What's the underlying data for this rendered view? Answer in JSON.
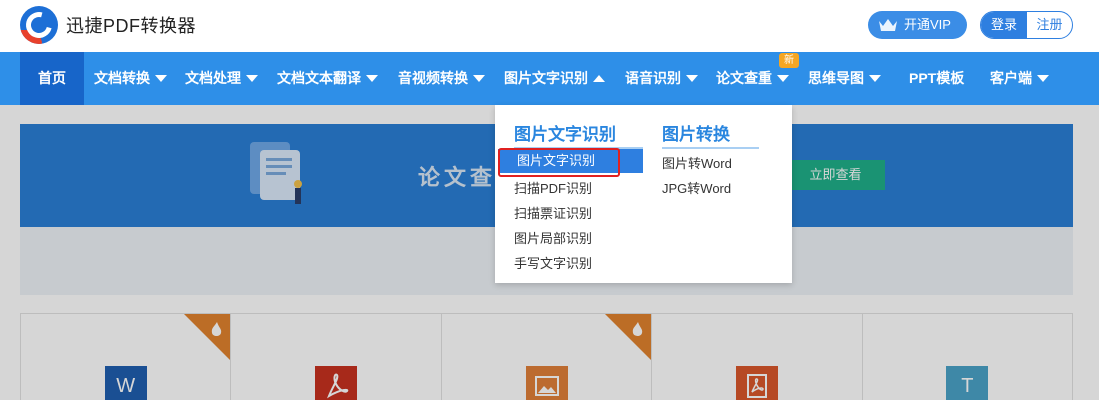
{
  "header": {
    "brand": "迅捷PDF转换器",
    "vip_label": "开通VIP",
    "login_label": "登录",
    "register_label": "注册"
  },
  "nav": {
    "items": [
      {
        "label": "首页"
      },
      {
        "label": "文档转换"
      },
      {
        "label": "文档处理"
      },
      {
        "label": "文档文本翻译"
      },
      {
        "label": "音视频转换"
      },
      {
        "label": "图片文字识别"
      },
      {
        "label": "语音识别"
      },
      {
        "label": "论文查重"
      },
      {
        "label": "思维导图"
      },
      {
        "label": "PPT模板"
      },
      {
        "label": "客户端"
      }
    ],
    "new_badge": "新"
  },
  "banner": {
    "text": "论文查",
    "button_label": "立即查看"
  },
  "dropdown": {
    "col1_title": "图片文字识别",
    "col1_items": [
      "图片文字识别",
      "扫描PDF识别",
      "扫描票证识别",
      "图片局部识别",
      "手写文字识别"
    ],
    "col2_title": "图片转换",
    "col2_items": [
      "图片转Word",
      "JPG转Word"
    ]
  },
  "cards": [
    {
      "icon": "word-icon",
      "glyph": "W",
      "color": "#1f5fb0",
      "hot": true
    },
    {
      "icon": "pdf-icon",
      "glyph": "",
      "color": "#c8321f",
      "hot": false
    },
    {
      "icon": "image-icon",
      "glyph": "",
      "color": "#e0803a",
      "hot": true
    },
    {
      "icon": "pdf-convert-icon",
      "glyph": "",
      "color": "#d9582b",
      "hot": false
    },
    {
      "icon": "text-icon",
      "glyph": "T",
      "color": "#4aa3c8",
      "hot": false
    }
  ],
  "colors": {
    "nav": "#2e8fe8",
    "nav_active": "#1765c9",
    "accent": "#2a86df",
    "highlight_border": "#e02020",
    "new_badge": "#f5a623"
  }
}
